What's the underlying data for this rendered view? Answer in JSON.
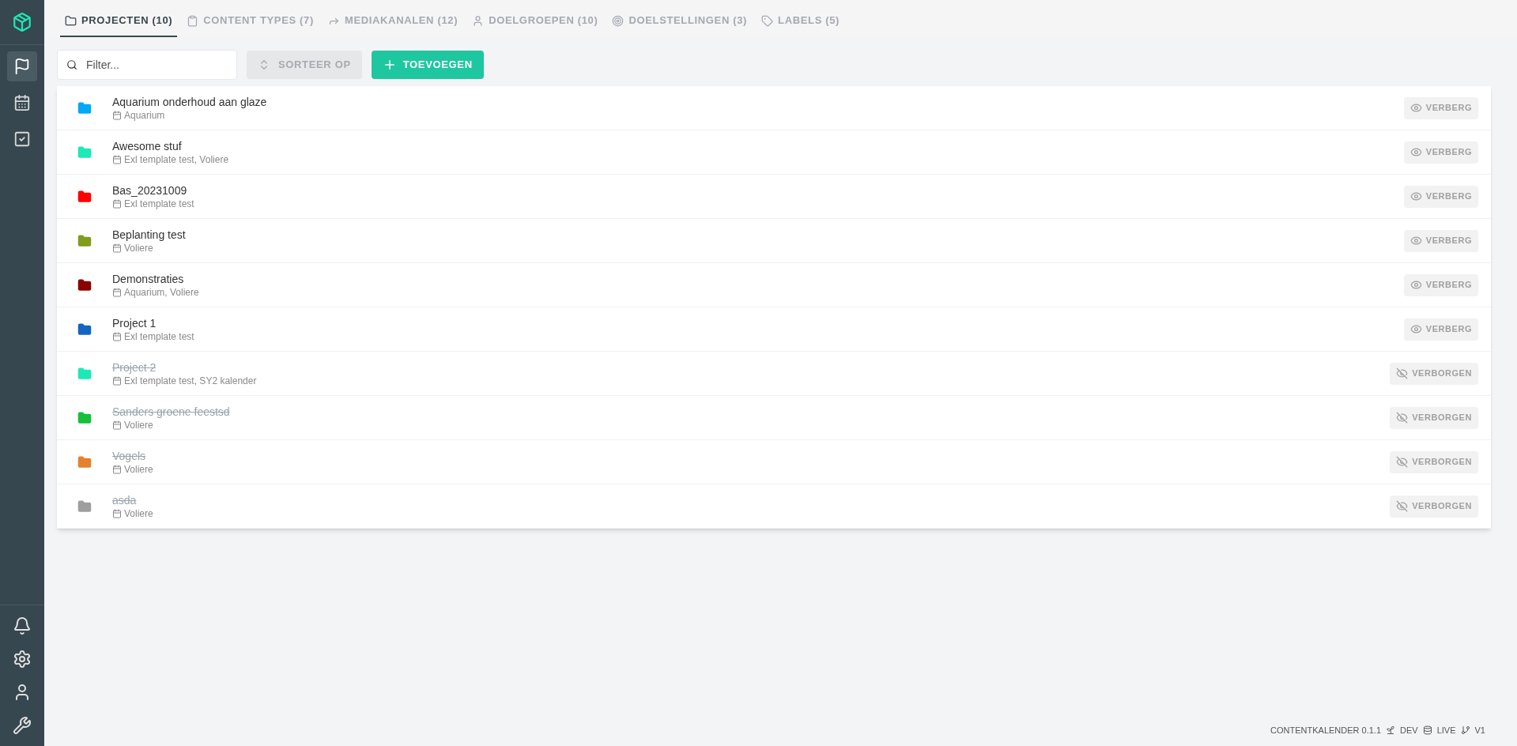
{
  "sidebar": {
    "items": [
      {
        "kind": "flag",
        "selected": true
      },
      {
        "kind": "calendar",
        "selected": false
      },
      {
        "kind": "checklist",
        "selected": false
      }
    ],
    "bottom_items": [
      {
        "kind": "bell"
      },
      {
        "kind": "settings"
      },
      {
        "kind": "user"
      },
      {
        "kind": "wrench"
      }
    ]
  },
  "tabs": [
    {
      "kind": "folder",
      "label": "PROJECTEN (10)",
      "selected": true
    },
    {
      "kind": "clipboard",
      "label": "CONTENT TYPES (7)",
      "selected": false
    },
    {
      "kind": "share",
      "label": "MEDIAKANALEN (12)",
      "selected": false
    },
    {
      "kind": "user",
      "label": "DOELGROEPEN (10)",
      "selected": false
    },
    {
      "kind": "target",
      "label": "DOELSTELLINGEN (3)",
      "selected": false
    },
    {
      "kind": "tag",
      "label": "LABELS (5)",
      "selected": false
    }
  ],
  "toolbar": {
    "filter": {
      "placeholder": "Filter..."
    },
    "sort_button": "SORTEER OP",
    "add_button": "TOEVOEGEN"
  },
  "projects": [
    {
      "name": "Aquarium onderhoud aan glaze",
      "calendars": "Aquarium",
      "color": "#03a9f4",
      "hidden": false,
      "action": "VERBERG"
    },
    {
      "name": "Awesome stuf",
      "calendars": "Exl template test, Voliere",
      "color": "#1de9b6",
      "hidden": false,
      "action": "VERBERG"
    },
    {
      "name": "Bas_20231009",
      "calendars": "Exl template test",
      "color": "#ff0000",
      "hidden": false,
      "action": "VERBERG"
    },
    {
      "name": "Beplanting test",
      "calendars": "Voliere",
      "color": "#7f9c1c",
      "hidden": false,
      "action": "VERBERG"
    },
    {
      "name": "Demonstraties",
      "calendars": "Aquarium, Voliere",
      "color": "#8b0000",
      "hidden": false,
      "action": "VERBERG"
    },
    {
      "name": "Project 1",
      "calendars": "Exl template test",
      "color": "#1565c0",
      "hidden": false,
      "action": "VERBERG"
    },
    {
      "name": "Project 2",
      "calendars": "Exl template test, SY2 kalender",
      "color": "#1de9b6",
      "hidden": true,
      "action": "VERBORGEN"
    },
    {
      "name": "Sanders groene feestsd",
      "calendars": "Voliere",
      "color": "#16c03a",
      "hidden": true,
      "action": "VERBORGEN"
    },
    {
      "name": "Vogels",
      "calendars": "Voliere",
      "color": "#e4812e",
      "hidden": true,
      "action": "VERBORGEN"
    },
    {
      "name": "asda",
      "calendars": "Voliere",
      "color": "#9e9e9e",
      "hidden": true,
      "action": "VERBORGEN"
    }
  ],
  "footer": {
    "app": "CONTENTKALENDER 0.1.1",
    "environment": "DEV",
    "database": "LIVE",
    "branch": "V1"
  }
}
